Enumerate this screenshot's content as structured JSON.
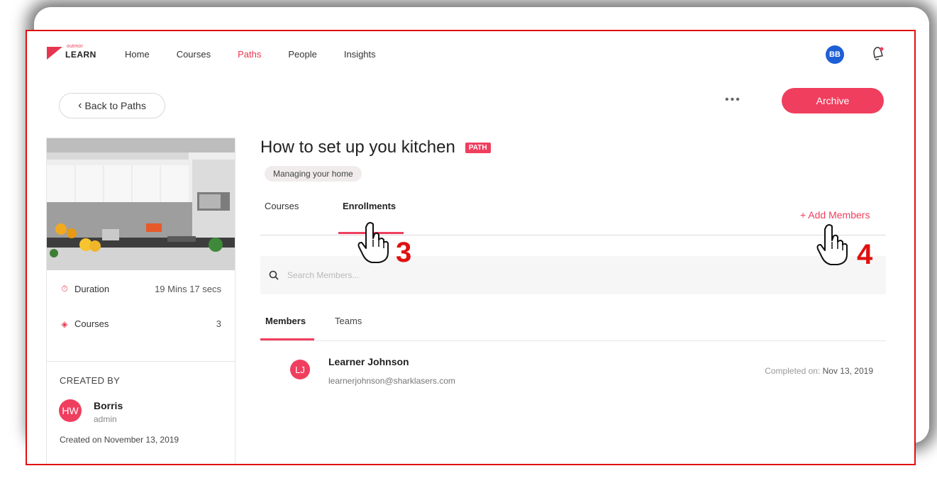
{
  "nav": {
    "logo_small": "outmor",
    "logo_big": "LEARN",
    "links": [
      {
        "label": "Home",
        "active": false
      },
      {
        "label": "Courses",
        "active": false
      },
      {
        "label": "Paths",
        "active": true
      },
      {
        "label": "People",
        "active": false
      },
      {
        "label": "Insights",
        "active": false
      }
    ],
    "user_initials": "BB"
  },
  "toolbar": {
    "back_label": "Back to Paths",
    "more_label": "•••",
    "archive_label": "Archive"
  },
  "path": {
    "title": "How to set up you kitchen",
    "badge": "PATH",
    "category": "Managing your home",
    "duration_label": "Duration",
    "duration_value": "19 Mins 17 secs",
    "courses_label": "Courses",
    "courses_value": "3",
    "created_by_label": "CREATED BY",
    "creator_initials": "HW",
    "creator_name": "Borris",
    "creator_role": "admin",
    "created_on": "Created on November 13, 2019"
  },
  "tabs": {
    "courses": "Courses",
    "enrollments": "Enrollments"
  },
  "add_members_label": "+ Add Members",
  "search": {
    "placeholder": "Search Members..."
  },
  "subtabs": {
    "members": "Members",
    "teams": "Teams"
  },
  "members": [
    {
      "initials": "LJ",
      "name": "Learner Johnson",
      "email": "learnerjohnson@sharklasers.com",
      "completed_label": "Completed on:",
      "completed_date": "Nov 13, 2019"
    }
  ],
  "annotations": {
    "step_enrollments": "3",
    "step_add_members": "4"
  },
  "colors": {
    "accent": "#f03e5e",
    "user_avatar": "#1f5fd6",
    "annotation_red": "#e01010"
  }
}
